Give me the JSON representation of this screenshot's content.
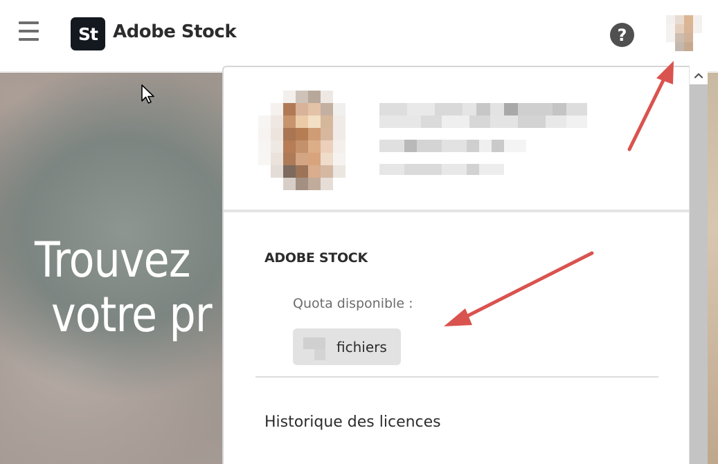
{
  "header": {
    "logo_text": "St",
    "brand_name": "Adobe Stock",
    "help_icon": "?"
  },
  "hero": {
    "line1": "Trouvez",
    "line2": "votre pr"
  },
  "account_menu": {
    "section_title": "ADOBE STOCK",
    "quota_label": "Quota disponible :",
    "quota_unit": "fichiers",
    "history_link": "Historique des licences"
  },
  "colors": {
    "logo_bg": "#14181f",
    "annotation_arrow": "#d9534f",
    "panel_border": "#d6d6d6",
    "quota_pill_bg": "#e2e2e2"
  },
  "icons": {
    "menu": "hamburger-icon",
    "help": "help-icon",
    "scroll_up": "chevron-up-icon",
    "pointer": "cursor-icon"
  }
}
